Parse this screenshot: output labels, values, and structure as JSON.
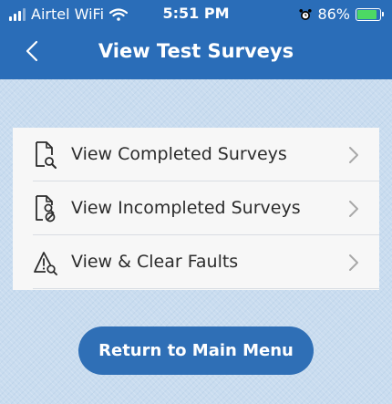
{
  "status_bar": {
    "carrier": "Airtel WiFi",
    "time": "5:51 PM",
    "battery": "86%",
    "battery_level": 0.86,
    "icons": [
      "signal-icon",
      "wifi-icon",
      "alarm-icon",
      "battery-charging-icon"
    ]
  },
  "header": {
    "title": "View Test Surveys",
    "back_icon": "chevron-left-icon"
  },
  "menu": {
    "items": [
      {
        "label": "View Completed Surveys",
        "icon": "document-search-icon"
      },
      {
        "label": "View Incompleted Surveys",
        "icon": "document-blocked-search-icon"
      },
      {
        "label": "View & Clear Faults",
        "icon": "warning-search-icon"
      }
    ]
  },
  "footer": {
    "return_label": "Return to Main Menu"
  },
  "colors": {
    "header": "#2a6db8",
    "button": "#2f6fb6",
    "background": "#c9dcef",
    "card": "#f7f7f7",
    "battery_fill": "#4cd964"
  }
}
